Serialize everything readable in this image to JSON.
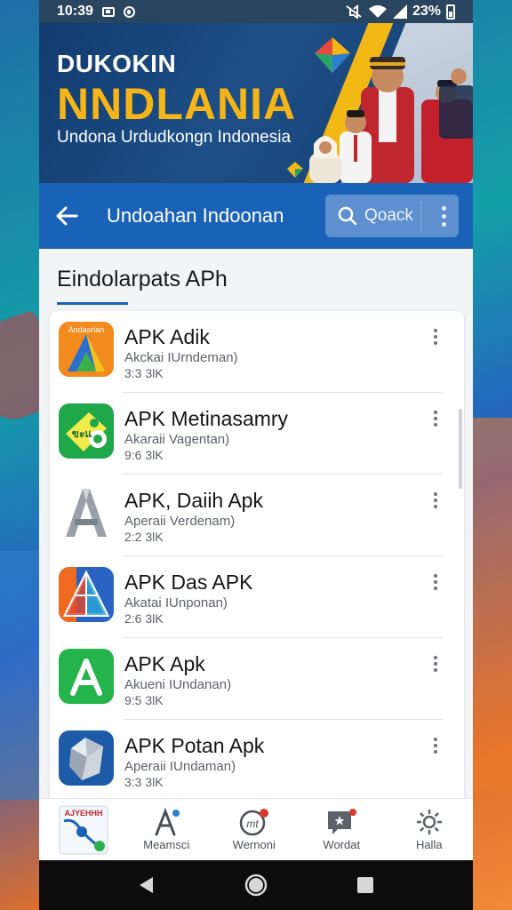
{
  "status_bar": {
    "time": "10:39",
    "battery": "23%"
  },
  "banner": {
    "kicker": "DUKOKIN",
    "title": "NNDLANIA",
    "subtitle": "Undona Urdudkongn Indonesia"
  },
  "app_bar": {
    "title": "Undoahan Indoonan",
    "search_placeholder": "Qoack"
  },
  "section": {
    "title": "Eindolarpats APh"
  },
  "apps": [
    {
      "name": "APK Adik",
      "subtitle": "Akckai IUrndeman)",
      "size": "3:3 3lK",
      "icon_label": "Andasrian",
      "icon": "orange-a-icon"
    },
    {
      "name": "APK Metinasamry",
      "subtitle": "Akaraii Vagentan)",
      "size": "9:6 3lK",
      "icon_label": "ขะแ",
      "icon": "green-tag-icon"
    },
    {
      "name": "APK, Daiih Apk",
      "subtitle": "Aperaii Verdenam)",
      "size": "2:2 3lK",
      "icon_label": "",
      "icon": "metal-a-icon"
    },
    {
      "name": "APK Das APK",
      "subtitle": "Akatai IUnponan)",
      "size": "2:6 3lK",
      "icon_label": "",
      "icon": "triangle-a-icon"
    },
    {
      "name": "APK Apk",
      "subtitle": "Akueni IUndanan)",
      "size": "9:5 3lK",
      "icon_label": "",
      "icon": "green-a-icon"
    },
    {
      "name": "APK Potan Apk",
      "subtitle": "Aperaii IUndaman)",
      "size": "3:3 3lK",
      "icon_label": "",
      "icon": "crystal-icon"
    }
  ],
  "bottom_nav": {
    "first_label": "AJYEHHH",
    "items": [
      {
        "label": "Meamsci",
        "icon": "compass-icon"
      },
      {
        "label": "Wernoni",
        "icon": "badge-icon",
        "icon_text": "mt"
      },
      {
        "label": "Wordat",
        "icon": "chat-icon"
      },
      {
        "label": "Halla",
        "icon": "gear-icon"
      }
    ]
  },
  "colors": {
    "primary": "#1a62b8",
    "banner_accent": "#f5b417"
  }
}
